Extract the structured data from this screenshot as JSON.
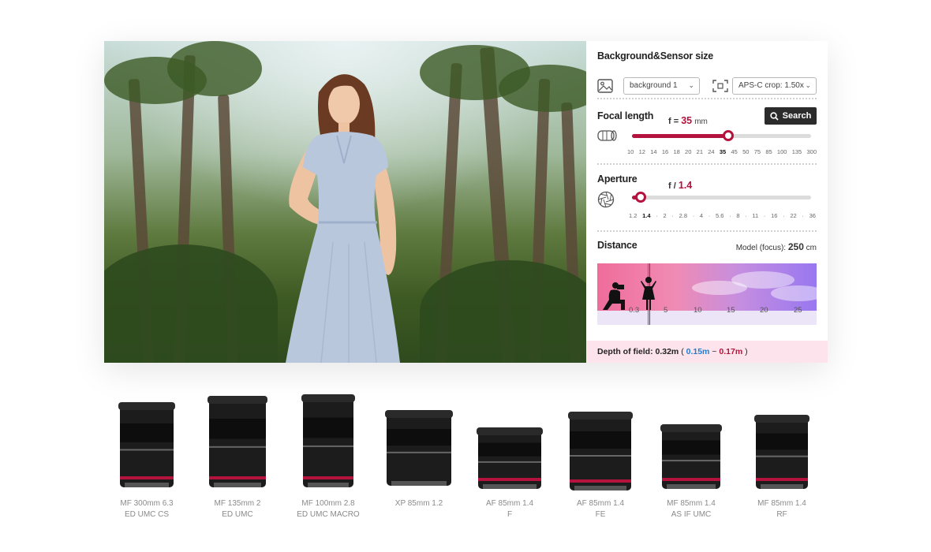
{
  "controls": {
    "background_sensor": {
      "title": "Background&Sensor size",
      "background_select": "background 1",
      "sensor_select": "APS-C crop: 1.50x"
    },
    "focal_length": {
      "title": "Focal length",
      "value_prefix": "f =",
      "value": "35",
      "unit": "mm",
      "search_label": "Search",
      "ticks": [
        "10",
        "12",
        "14",
        "16",
        "18",
        "20",
        "21",
        "24",
        "35",
        "45",
        "50",
        "75",
        "85",
        "100",
        "135",
        "300"
      ],
      "selected_index": 8
    },
    "aperture": {
      "title": "Aperture",
      "value_prefix": "f /",
      "value": "1.4",
      "ticks": [
        "1.2",
        "1.4",
        "·",
        "2",
        "·",
        "2.8",
        "·",
        "4",
        "·",
        "5.6",
        "·",
        "8",
        "·",
        "11",
        "·",
        "16",
        "·",
        "22",
        "·",
        "36"
      ],
      "selected_index": 1
    },
    "distance": {
      "title": "Distance",
      "model_label": "Model (focus):",
      "model_value": "250",
      "model_unit": "cm",
      "scale": [
        "0.3",
        "5",
        "10",
        "15",
        "20",
        "25"
      ]
    },
    "dof": {
      "label": "Depth of field:",
      "total": "0.32m",
      "open": "(",
      "near": "0.15m",
      "sep": "~",
      "far": "0.17m",
      "close": ")"
    }
  },
  "lenses": [
    {
      "line1": "MF 300mm 6.3",
      "line2": "ED UMC CS"
    },
    {
      "line1": "MF 135mm 2",
      "line2": "ED UMC"
    },
    {
      "line1": "MF 100mm 2.8",
      "line2": "ED UMC MACRO"
    },
    {
      "line1": "XP 85mm 1.2",
      "line2": ""
    },
    {
      "line1": "AF 85mm 1.4",
      "line2": "F"
    },
    {
      "line1": "AF 85mm 1.4",
      "line2": "FE"
    },
    {
      "line1": "MF 85mm 1.4",
      "line2": "AS IF UMC"
    },
    {
      "line1": "MF 85mm 1.4",
      "line2": "RF"
    }
  ],
  "colors": {
    "accent": "#b4133d",
    "near_color": "#1b7fd3",
    "dof_bar": "#fde4ec"
  },
  "icons": [
    "image-icon",
    "crop-icon",
    "search-icon",
    "lens-barrel-icon",
    "aperture-icon",
    "photographer-icon",
    "model-silhouette-icon"
  ]
}
